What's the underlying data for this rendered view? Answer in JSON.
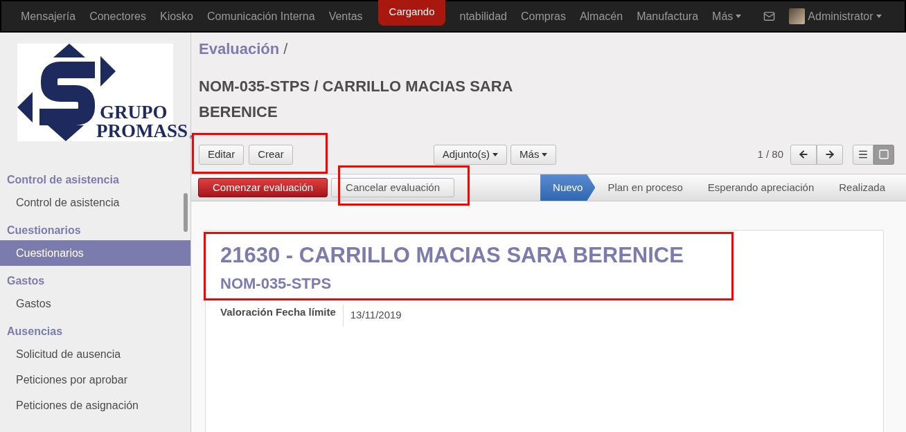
{
  "topbar": {
    "menu": [
      "Mensajería",
      "Conectores",
      "Kiosko",
      "Comunicación Interna",
      "Ventas",
      "ntabilidad",
      "Compras",
      "Almacén",
      "Manufactura"
    ],
    "more": "Más",
    "user": "Administrator",
    "loading": "Cargando"
  },
  "sidebar": {
    "logo": {
      "line1": "GRUPO",
      "line2": "PROMASS",
      "mark": "®"
    },
    "sections": [
      {
        "title": "Control de asistencia",
        "items": [
          {
            "label": "Control de asistencia",
            "selected": false
          }
        ]
      },
      {
        "title": "Cuestionarios",
        "items": [
          {
            "label": "Cuestionarios",
            "selected": true
          }
        ]
      },
      {
        "title": "Gastos",
        "items": [
          {
            "label": "Gastos",
            "selected": false
          }
        ]
      },
      {
        "title": "Ausencias",
        "items": [
          {
            "label": "Solicitud de ausencia",
            "selected": false
          },
          {
            "label": "Peticiones por aprobar",
            "selected": false
          },
          {
            "label": "Peticiones de asignación",
            "selected": false
          }
        ]
      }
    ]
  },
  "breadcrumb": {
    "parent": "Evaluación",
    "separator": "/",
    "title": "NOM-035-STPS / CARRILLO MACIAS SARA BERENICE"
  },
  "toolbar": {
    "left": [
      "Editar",
      "Crear"
    ],
    "dropdowns": [
      "Adjunto(s)",
      "Más"
    ],
    "pager": "1 / 80"
  },
  "statusbar": {
    "buttons": [
      {
        "label": "Comenzar evaluación",
        "kind": "primary"
      },
      {
        "label": "Cancelar evaluación",
        "kind": "default"
      }
    ],
    "stages": [
      {
        "label": "Nuevo",
        "selected": true
      },
      {
        "label": "Plan en proceso",
        "selected": false
      },
      {
        "label": "Esperando apreciación",
        "selected": false
      },
      {
        "label": "Realizada",
        "selected": false
      }
    ]
  },
  "sheet": {
    "title": "21630 - CARRILLO MACIAS SARA BERENICE",
    "subtitle": "NOM-035-STPS",
    "fields": [
      {
        "label": "Valoración Fecha límite",
        "value": "13/11/2019"
      }
    ]
  }
}
